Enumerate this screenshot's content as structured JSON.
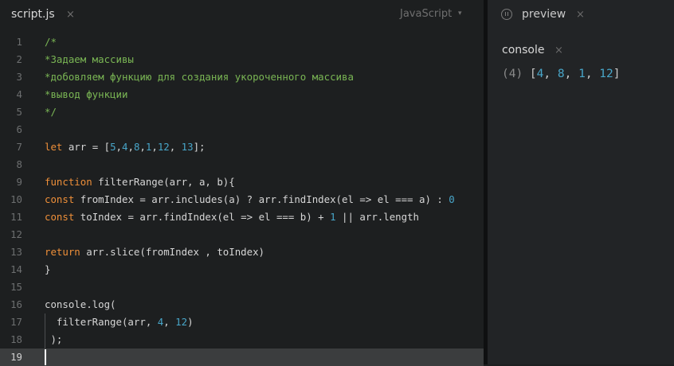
{
  "editor": {
    "file_tab": "script.js",
    "tab_close": "×",
    "language": "JavaScript",
    "language_caret": "▾",
    "active_line": 19,
    "lines": [
      {
        "n": "1",
        "tokens": [
          {
            "t": "/*",
            "c": "comment"
          }
        ]
      },
      {
        "n": "2",
        "tokens": [
          {
            "t": "*Задаем массивы",
            "c": "comment"
          }
        ]
      },
      {
        "n": "3",
        "tokens": [
          {
            "t": "*добовляем функцию для создания укороченного массива",
            "c": "comment"
          }
        ]
      },
      {
        "n": "4",
        "tokens": [
          {
            "t": "*вывод функции",
            "c": "comment"
          }
        ]
      },
      {
        "n": "5",
        "tokens": [
          {
            "t": "*/",
            "c": "comment"
          }
        ]
      },
      {
        "n": "6",
        "tokens": []
      },
      {
        "n": "7",
        "tokens": [
          {
            "t": "let",
            "c": "kw"
          },
          {
            "t": " arr = [",
            "c": "plain"
          },
          {
            "t": "5",
            "c": "num"
          },
          {
            "t": ",",
            "c": "plain"
          },
          {
            "t": "4",
            "c": "num"
          },
          {
            "t": ",",
            "c": "plain"
          },
          {
            "t": "8",
            "c": "num"
          },
          {
            "t": ",",
            "c": "plain"
          },
          {
            "t": "1",
            "c": "num"
          },
          {
            "t": ",",
            "c": "plain"
          },
          {
            "t": "12",
            "c": "num"
          },
          {
            "t": ", ",
            "c": "plain"
          },
          {
            "t": "13",
            "c": "num"
          },
          {
            "t": "];",
            "c": "plain"
          }
        ]
      },
      {
        "n": "8",
        "tokens": []
      },
      {
        "n": "9",
        "tokens": [
          {
            "t": "function",
            "c": "kw"
          },
          {
            "t": " filterRange(arr, a, b){",
            "c": "plain"
          }
        ]
      },
      {
        "n": "10",
        "tokens": [
          {
            "t": "const",
            "c": "kw"
          },
          {
            "t": " fromIndex = arr.includes(a) ? arr.findIndex(el => el === a) : ",
            "c": "plain"
          },
          {
            "t": "0",
            "c": "num"
          }
        ]
      },
      {
        "n": "11",
        "tokens": [
          {
            "t": "const",
            "c": "kw"
          },
          {
            "t": " toIndex = arr.findIndex(el => el === b) + ",
            "c": "plain"
          },
          {
            "t": "1",
            "c": "num"
          },
          {
            "t": " || arr.length",
            "c": "plain"
          }
        ]
      },
      {
        "n": "12",
        "tokens": []
      },
      {
        "n": "13",
        "tokens": [
          {
            "t": "return",
            "c": "kw"
          },
          {
            "t": " arr.slice(fromIndex , toIndex)",
            "c": "plain"
          }
        ]
      },
      {
        "n": "14",
        "tokens": [
          {
            "t": "}",
            "c": "plain"
          }
        ]
      },
      {
        "n": "15",
        "tokens": []
      },
      {
        "n": "16",
        "tokens": [
          {
            "t": "console.log(",
            "c": "plain"
          }
        ]
      },
      {
        "n": "17",
        "tokens": [
          {
            "t": "  filterRange(arr, ",
            "c": "plain"
          },
          {
            "t": "4",
            "c": "num"
          },
          {
            "t": ", ",
            "c": "plain"
          },
          {
            "t": "12",
            "c": "num"
          },
          {
            "t": ")",
            "c": "plain"
          }
        ],
        "guide": true
      },
      {
        "n": "18",
        "tokens": [
          {
            "t": " );",
            "c": "plain"
          }
        ],
        "guide": true
      },
      {
        "n": "19",
        "tokens": []
      }
    ]
  },
  "preview": {
    "tab_label": "preview",
    "tab_close": "×",
    "console_tab": "console",
    "console_close": "×",
    "output_count": "(4)",
    "output_open": " [",
    "output_values": [
      "4",
      "8",
      "1",
      "12"
    ],
    "output_close": "]"
  },
  "colors": {
    "comment": "#7ab654",
    "keyword": "#ee8f39",
    "number": "#48a6c9",
    "text": "#d6d6d6",
    "background": "#1d1f20"
  }
}
